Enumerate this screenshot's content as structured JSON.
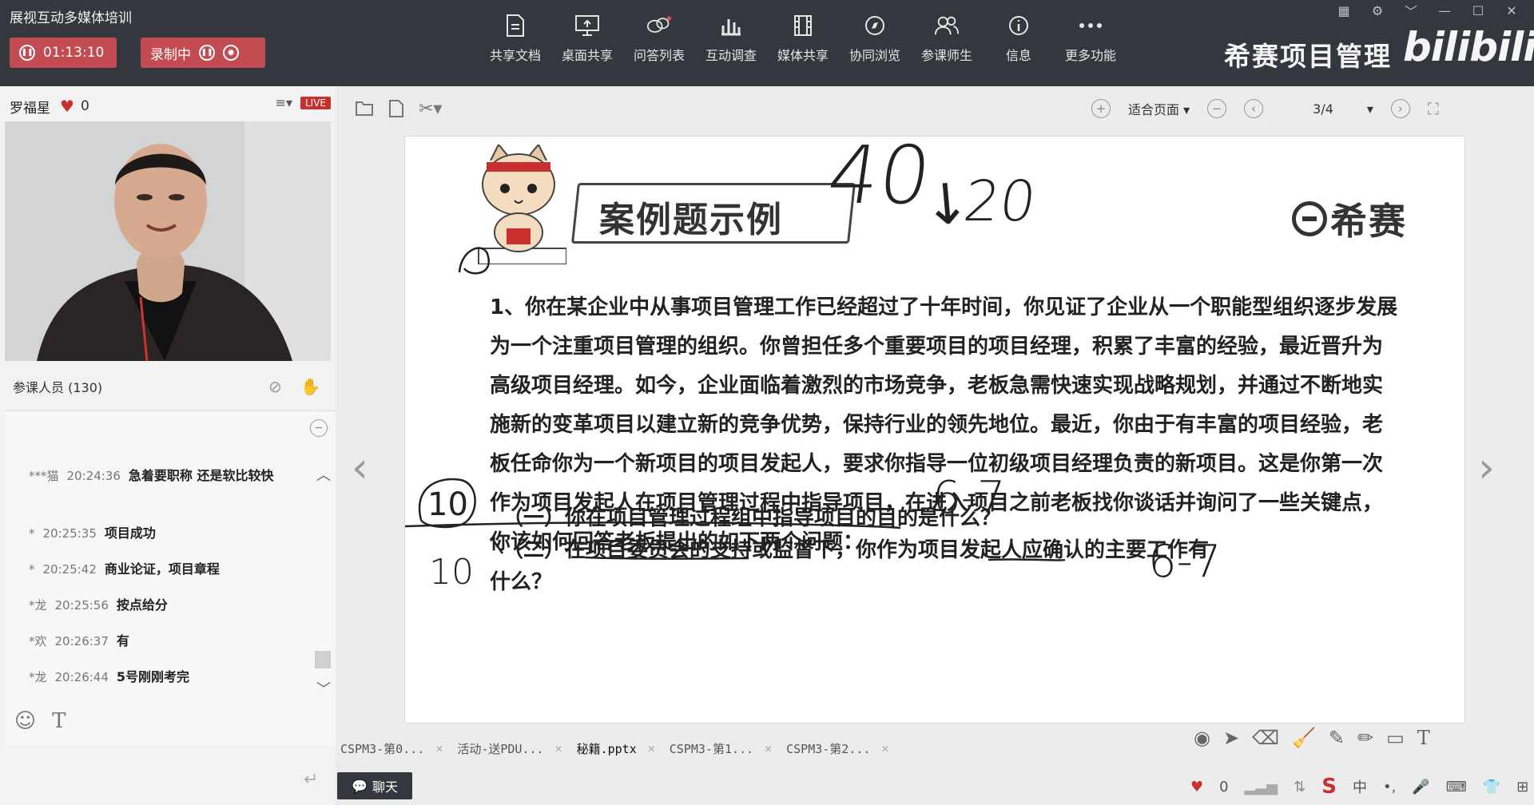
{
  "app": {
    "title": "展视互动多媒体培训"
  },
  "recording": {
    "timer": "01:13:10",
    "status_label": "录制中"
  },
  "toolbar": {
    "items": [
      {
        "label": "共享文档",
        "icon": "document-share-icon"
      },
      {
        "label": "桌面共享",
        "icon": "desktop-share-icon"
      },
      {
        "label": "问答列表",
        "icon": "qa-list-icon"
      },
      {
        "label": "互动调查",
        "icon": "bar-chart-icon"
      },
      {
        "label": "媒体共享",
        "icon": "film-icon"
      },
      {
        "label": "协同浏览",
        "icon": "compass-icon"
      },
      {
        "label": "参课师生",
        "icon": "users-icon"
      },
      {
        "label": "信息",
        "icon": "info-icon"
      },
      {
        "label": "更多功能",
        "icon": "more-icon"
      }
    ]
  },
  "brand": {
    "name": "希赛项目管理",
    "bilibili": "bilibili"
  },
  "left": {
    "teacher_name": "罗福星",
    "likes": "0",
    "live_badge": "LIVE",
    "participants_label": "参课人员 (130)"
  },
  "chat": {
    "messages": [
      {
        "user": "***猫",
        "time": "20:24:36",
        "text": "急着要职称  还是软比较快"
      },
      {
        "user": "*",
        "time": "20:25:35",
        "text": "项目成功"
      },
      {
        "user": "*",
        "time": "20:25:42",
        "text": "商业论证，项目章程"
      },
      {
        "user": "*龙",
        "time": "20:25:56",
        "text": "按点给分"
      },
      {
        "user": "*欢",
        "time": "20:26:37",
        "text": "有"
      },
      {
        "user": "*龙",
        "time": "20:26:44",
        "text": "5号刚刚考完"
      }
    ],
    "button_label": "聊天"
  },
  "viewer": {
    "zoom_label": "适合页面",
    "page_indicator": "3/4"
  },
  "slide": {
    "title": "案例题示例",
    "logo_text": "希赛",
    "question_paragraph": "1、你在某企业中从事项目管理工作已经超过了十年时间，你见证了企业从一个职能型组织逐步发展为一个注重项目管理的组织。你曾担任多个重要项目的项目经理，积累了丰富的经验，最近晋升为高级项目经理。如今，企业面临着激烈的市场竞争，老板急需快速实现战略规划，并通过不断地实施新的变革项目以建立新的竞争优势，保持行业的领先地位。最近，你由于有丰富的项目经验，老板任命你为一个新项目的项目发起人，要求你指导一位初级项目经理负责的新项目。这是你第一次作为项目发起人在项目管理过程中指导项目，在进入项目之前老板找你谈话并询问了一些关键点，你该如何回答老板提出的如下两个问题：",
    "sub_q1": "（一）你在项目管理过程组中指导项目的目的是什么？",
    "sub_q2a": "（二）在项目委员会的支持或监督下，你作为项目发起人应确认的主要工作有",
    "sub_q2b": "什么？",
    "handwriting": {
      "h1": "40",
      "h2": "20",
      "h3": "10",
      "h4": "6-7",
      "h5": "10",
      "h6": "6-7"
    }
  },
  "file_tabs": [
    {
      "label": "CSPM3-第0..."
    },
    {
      "label": "活动-送PDU..."
    },
    {
      "label": "秘籍.pptx"
    },
    {
      "label": "CSPM3-第1..."
    },
    {
      "label": "CSPM3-第2..."
    }
  ],
  "bottom": {
    "likes": "0",
    "ime_label": "中"
  }
}
